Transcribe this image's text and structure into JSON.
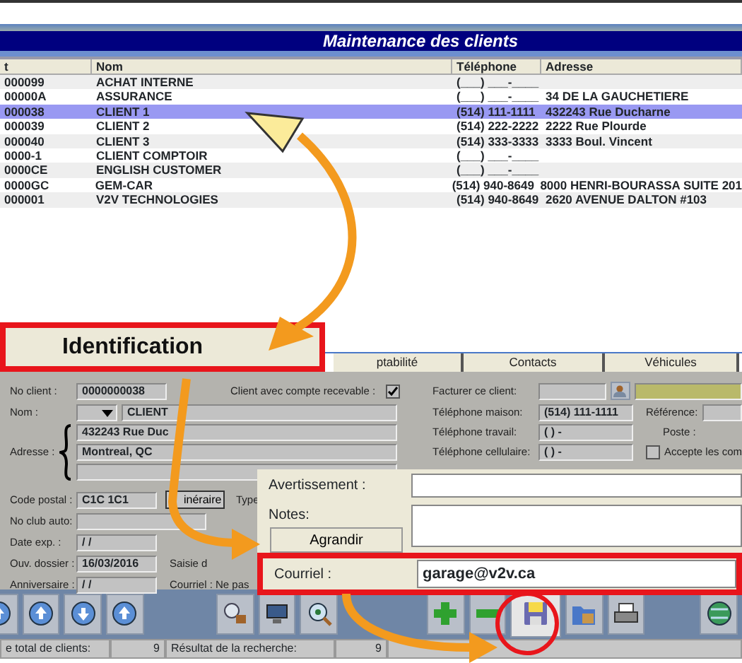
{
  "title": "Maintenance des clients",
  "table": {
    "columns": [
      "t",
      "Nom",
      "Téléphone",
      "Adresse"
    ],
    "rows": [
      {
        "cells": [
          "000099",
          "ACHAT INTERNE",
          "(___) ___-____",
          null
        ],
        "selected": false
      },
      {
        "cells": [
          "00000A",
          "ASSURANCE",
          "(___) ___-____",
          "34 DE LA GAUCHETIERE"
        ],
        "selected": false
      },
      {
        "cells": [
          "000038",
          "CLIENT 1",
          "(514) 111-1111",
          "432243 Rue Ducharne"
        ],
        "selected": true
      },
      {
        "cells": [
          "000039",
          "CLIENT 2",
          "(514) 222-2222",
          "2222 Rue Plourde"
        ],
        "selected": false
      },
      {
        "cells": [
          "000040",
          "CLIENT 3",
          "(514) 333-3333",
          "3333 Boul. Vincent"
        ],
        "selected": false
      },
      {
        "cells": [
          "0000-1",
          "CLIENT COMPTOIR",
          "(___) ___-____",
          null
        ],
        "selected": false
      },
      {
        "cells": [
          "0000CE",
          "ENGLISH CUSTOMER",
          "(___) ___-____",
          null
        ],
        "selected": false
      },
      {
        "cells": [
          "0000GC",
          "GEM-CAR",
          "(514) 940-8649",
          "8000 HENRI-BOURASSA SUITE 201"
        ],
        "selected": false
      },
      {
        "cells": [
          "000001",
          "V2V TECHNOLOGIES",
          "(514) 940-8649",
          "2620 AVENUE DALTON #103"
        ],
        "selected": false
      }
    ]
  },
  "tabs": [
    {
      "label": "Identification",
      "selected": true
    },
    {
      "label": "ptabilité",
      "selected": false
    },
    {
      "label": "Contacts",
      "selected": false
    },
    {
      "label": "Véhicules",
      "selected": false
    }
  ],
  "form": {
    "client_no": {
      "label": "No client :",
      "value": "0000000038"
    },
    "receivable": {
      "label": "Client avec compte recevable :",
      "checked": true
    },
    "name": {
      "label": "Nom :",
      "value": "CLIENT"
    },
    "address": {
      "label": "Adresse :",
      "lines": [
        "432243 Rue Duc",
        "Montreal, QC"
      ]
    },
    "postal": {
      "label": "Code postal :",
      "value": "C1C 1C1",
      "button": "inéraire",
      "type_label": "Type"
    },
    "club": {
      "label": "No club auto:"
    },
    "dates": [
      {
        "label": "Date exp. :",
        "value": "/ /"
      },
      {
        "label": "Ouv. dossier :",
        "value": "16/03/2016",
        "note": "Saisie d"
      },
      {
        "label": "Anniversaire :",
        "value": "/ /",
        "note": "Courriel : Ne pas"
      }
    ],
    "bill": {
      "label": "Facturer ce client:"
    },
    "phones": [
      {
        "label": "Téléphone maison:",
        "value": "(514) 111-1111"
      },
      {
        "label": "Téléphone travail:",
        "value": "(  )    -"
      },
      {
        "label": "Téléphone cellulaire:",
        "value": "(  )    -"
      }
    ],
    "reference": {
      "label": "Référence:"
    },
    "poste": {
      "label": "Poste :"
    },
    "accept": {
      "label": "Accepte les com",
      "checked": false
    }
  },
  "popup": {
    "warning_label": "Avertissement :",
    "notes_label": "Notes:",
    "enlarge_button": "Agrandir",
    "email_label": "Courriel :",
    "email": "garage@v2v.ca"
  },
  "status": [
    {
      "label": "e total de clients:",
      "value": "9"
    },
    {
      "label": "Résultat de la recherche:",
      "value": "9"
    }
  ]
}
